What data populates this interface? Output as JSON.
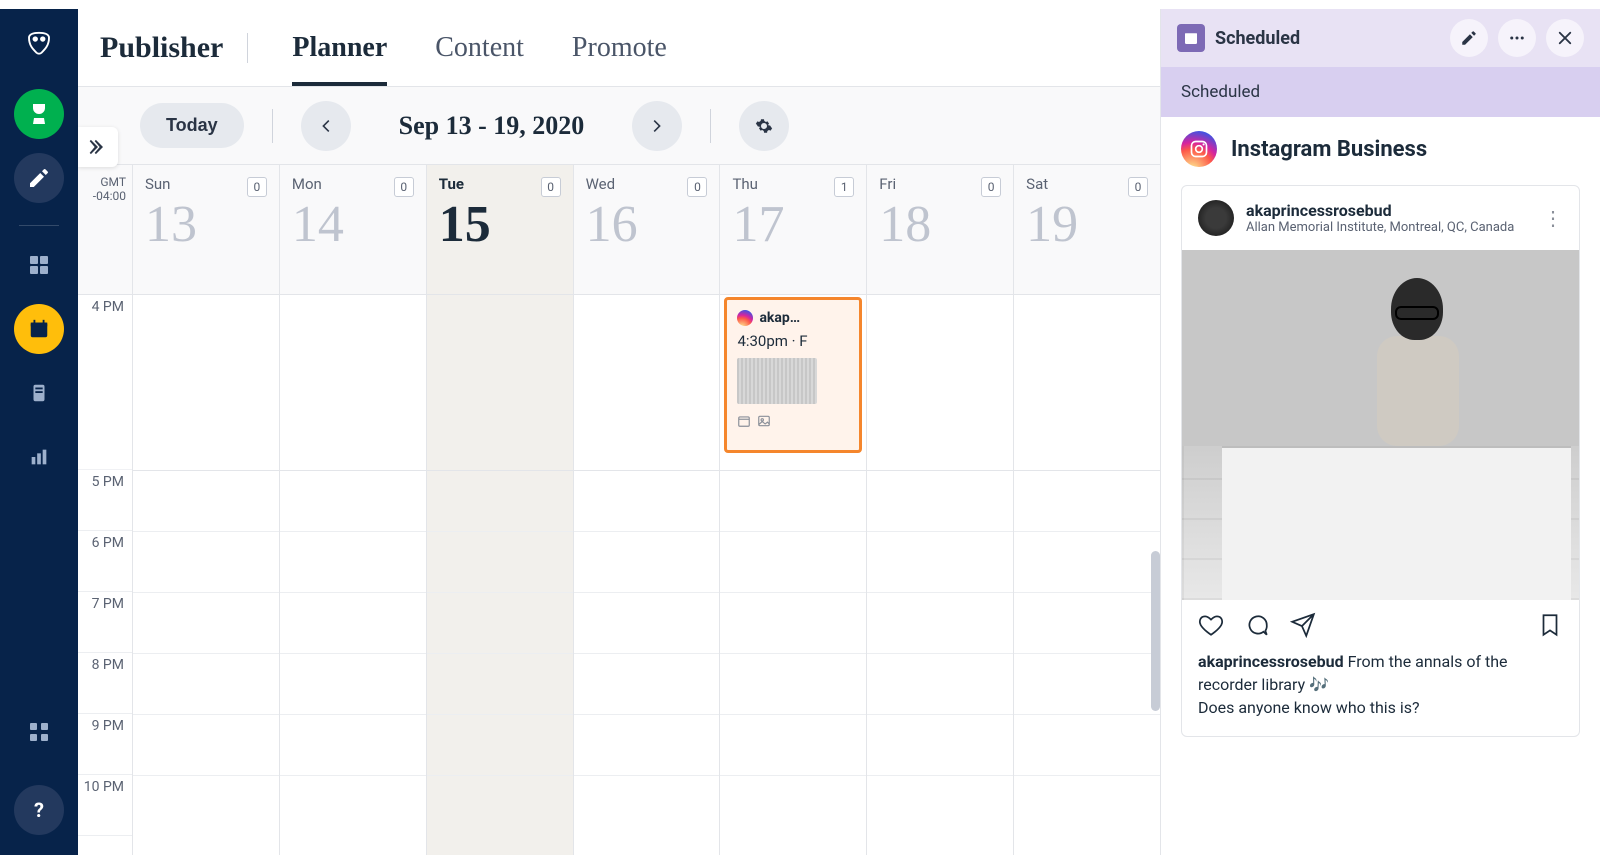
{
  "app": {
    "title": "Publisher"
  },
  "tabs": [
    {
      "label": "Planner",
      "active": true
    },
    {
      "label": "Content",
      "active": false
    },
    {
      "label": "Promote",
      "active": false
    }
  ],
  "toolbar": {
    "today": "Today",
    "date_range": "Sep 13 - 19, 2020"
  },
  "timezone": {
    "label": "GMT",
    "offset": "-04:00"
  },
  "hours": [
    "4 PM",
    "5 PM",
    "6 PM",
    "7 PM",
    "8 PM",
    "9 PM",
    "10 PM"
  ],
  "days": [
    {
      "short": "Sun",
      "num": "13",
      "count": "0",
      "today": false
    },
    {
      "short": "Mon",
      "num": "14",
      "count": "0",
      "today": false
    },
    {
      "short": "Tue",
      "num": "15",
      "count": "0",
      "today": true
    },
    {
      "short": "Wed",
      "num": "16",
      "count": "0",
      "today": false
    },
    {
      "short": "Thu",
      "num": "17",
      "count": "1",
      "today": false
    },
    {
      "short": "Fri",
      "num": "18",
      "count": "0",
      "today": false
    },
    {
      "short": "Sat",
      "num": "19",
      "count": "0",
      "today": false
    }
  ],
  "event": {
    "account_short": "akap…",
    "time_line": "4:30pm · F"
  },
  "detail": {
    "header": "Scheduled",
    "status": "Scheduled",
    "network": "Instagram Business",
    "post": {
      "username": "akaprincessrosebud",
      "location": "Allan Memorial Institute, Montreal, QC, Canada",
      "caption_user": "akaprincessrosebud",
      "caption_line1": "From the annals of the recorder library 🎶",
      "caption_line2": "Does anyone know who this is?"
    }
  }
}
